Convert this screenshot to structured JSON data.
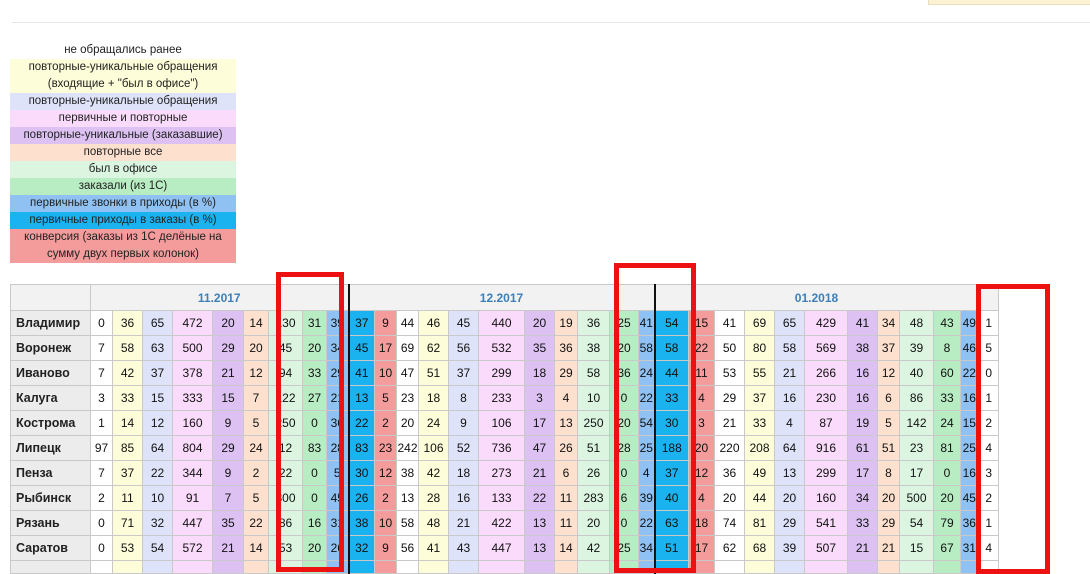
{
  "colors": {
    "c0": "#ffffff",
    "c1": "#fdfdd9",
    "c2": "#dfe3fa",
    "c3": "#fbdbfb",
    "c4": "#dcc1f2",
    "c5": "#fde0cd",
    "c6": "#dbf5e1",
    "c7": "#b8ecc2",
    "c8": "#8fc2f2",
    "c9": "#1ab2ef",
    "c10": "#f49b9b",
    "box": "#ee1111"
  },
  "legend": [
    {
      "text": "не обращались ранее",
      "color": "#ffffff"
    },
    {
      "text": "повторные-уникальные обращения (входящие + \"был в офисе\")",
      "color": "#fdfdd9",
      "two": true
    },
    {
      "text": "повторные-уникальные обращения",
      "color": "#dfe3fa"
    },
    {
      "text": "первичные и повторные",
      "color": "#fbdbfb"
    },
    {
      "text": "повторные-уникальные (заказавшие)",
      "color": "#dcc1f2"
    },
    {
      "text": "повторные все",
      "color": "#fde0cd"
    },
    {
      "text": "был в офисе",
      "color": "#dbf5e1"
    },
    {
      "text": "заказали (из 1С)",
      "color": "#b8ecc2"
    },
    {
      "text": "первичные звонки в приходы (в %)",
      "color": "#8fc2f2"
    },
    {
      "text": "первичные приходы в заказы (в %)",
      "color": "#1ab2ef"
    },
    {
      "text": "конверсия (заказы из 1С делёные на сумму двух первых колонок)",
      "color": "#f49b9b",
      "two": true
    }
  ],
  "months": [
    "11.2017",
    "12.2017",
    "01.2018"
  ],
  "cities": [
    "Владимир",
    "Воронеж",
    "Иваново",
    "Калуга",
    "Кострома",
    "Липецк",
    "Пенза",
    "Рыбинск",
    "Рязань",
    "Саратов"
  ],
  "rows": [
    [
      "0",
      "36",
      "65",
      "472",
      "20",
      "14",
      "130",
      "31",
      "39",
      "37",
      "9",
      "44",
      "46",
      "45",
      "440",
      "20",
      "19",
      "36",
      "25",
      "41",
      "54",
      "15",
      "41",
      "69",
      "65",
      "429",
      "41",
      "34",
      "48",
      "43",
      "49",
      "1"
    ],
    [
      "7",
      "58",
      "63",
      "500",
      "29",
      "20",
      "45",
      "20",
      "34",
      "45",
      "17",
      "69",
      "62",
      "56",
      "532",
      "35",
      "36",
      "38",
      "20",
      "58",
      "58",
      "22",
      "50",
      "80",
      "58",
      "569",
      "38",
      "37",
      "39",
      "8",
      "46",
      "5"
    ],
    [
      "7",
      "42",
      "37",
      "378",
      "21",
      "12",
      "94",
      "33",
      "29",
      "41",
      "10",
      "47",
      "51",
      "37",
      "299",
      "18",
      "29",
      "58",
      "36",
      "24",
      "44",
      "11",
      "53",
      "55",
      "21",
      "266",
      "16",
      "12",
      "40",
      "60",
      "22",
      "0"
    ],
    [
      "3",
      "33",
      "15",
      "333",
      "15",
      "7",
      "122",
      "27",
      "21",
      "13",
      "5",
      "23",
      "18",
      "8",
      "233",
      "3",
      "4",
      "10",
      "0",
      "22",
      "33",
      "4",
      "29",
      "37",
      "16",
      "230",
      "16",
      "6",
      "86",
      "33",
      "16",
      "1"
    ],
    [
      "1",
      "14",
      "12",
      "160",
      "9",
      "5",
      "250",
      "0",
      "36",
      "22",
      "2",
      "20",
      "24",
      "9",
      "106",
      "17",
      "13",
      "250",
      "20",
      "54",
      "30",
      "3",
      "21",
      "33",
      "4",
      "87",
      "19",
      "5",
      "142",
      "24",
      "15",
      "2"
    ],
    [
      "97",
      "85",
      "64",
      "804",
      "29",
      "24",
      "12",
      "83",
      "28",
      "83",
      "23",
      "242",
      "106",
      "52",
      "736",
      "47",
      "26",
      "51",
      "28",
      "25",
      "188",
      "20",
      "220",
      "208",
      "64",
      "916",
      "61",
      "51",
      "23",
      "81",
      "25",
      "4"
    ],
    [
      "7",
      "37",
      "22",
      "344",
      "9",
      "2",
      "22",
      "0",
      "5",
      "30",
      "12",
      "38",
      "42",
      "18",
      "273",
      "21",
      "6",
      "26",
      "0",
      "4",
      "37",
      "12",
      "36",
      "49",
      "13",
      "299",
      "17",
      "8",
      "17",
      "0",
      "16",
      "3"
    ],
    [
      "2",
      "11",
      "10",
      "91",
      "7",
      "5",
      "300",
      "0",
      "45",
      "26",
      "2",
      "13",
      "28",
      "16",
      "133",
      "22",
      "11",
      "283",
      "6",
      "39",
      "40",
      "4",
      "20",
      "44",
      "20",
      "160",
      "34",
      "20",
      "500",
      "20",
      "45",
      "2"
    ],
    [
      "0",
      "71",
      "32",
      "447",
      "35",
      "22",
      "86",
      "16",
      "31",
      "38",
      "10",
      "58",
      "48",
      "21",
      "422",
      "13",
      "11",
      "20",
      "0",
      "22",
      "63",
      "18",
      "74",
      "81",
      "29",
      "541",
      "33",
      "29",
      "54",
      "79",
      "36",
      "1"
    ],
    [
      "0",
      "53",
      "54",
      "572",
      "21",
      "14",
      "53",
      "20",
      "26",
      "32",
      "9",
      "56",
      "41",
      "43",
      "447",
      "13",
      "14",
      "42",
      "25",
      "34",
      "51",
      "17",
      "62",
      "68",
      "39",
      "507",
      "21",
      "21",
      "15",
      "67",
      "31",
      "4"
    ]
  ]
}
